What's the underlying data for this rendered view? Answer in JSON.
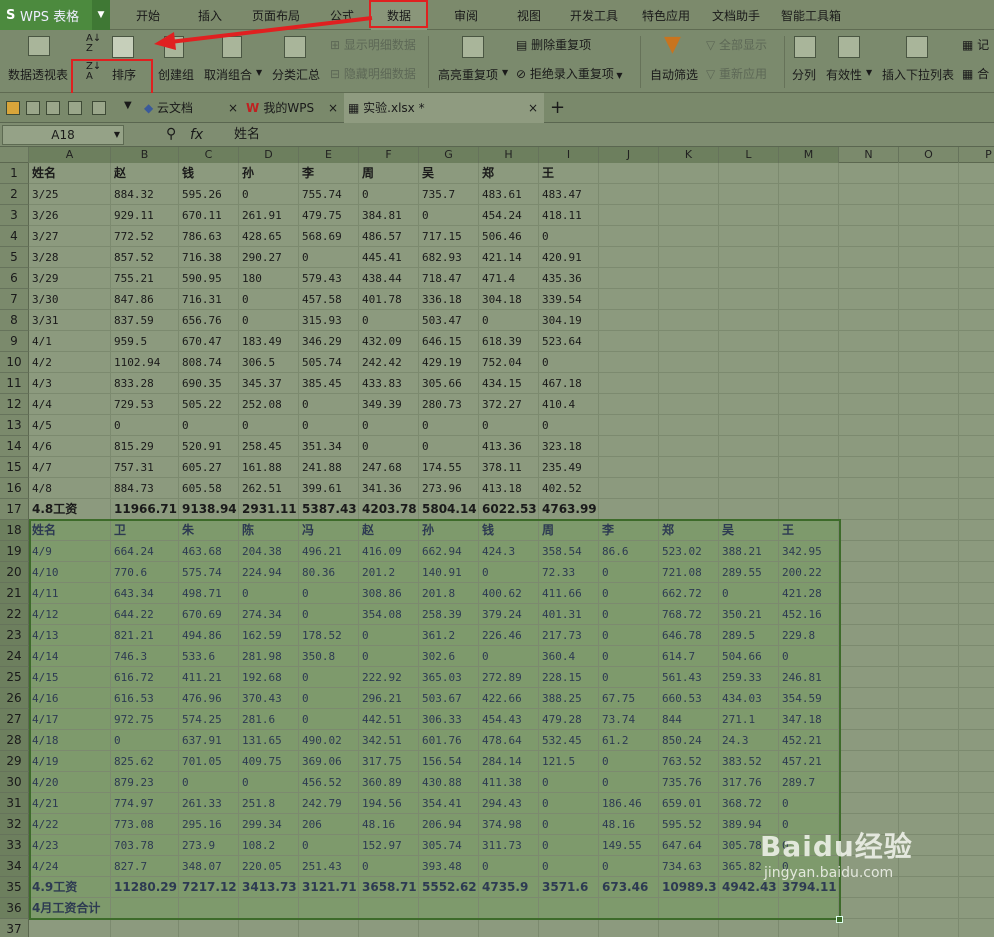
{
  "app": {
    "title": "WPS 表格"
  },
  "menu": {
    "tabs": [
      "开始",
      "插入",
      "页面布局",
      "公式",
      "数据",
      "审阅",
      "视图",
      "开发工具",
      "特色应用",
      "文档助手",
      "智能工具箱"
    ],
    "active": "数据"
  },
  "ribbon": {
    "pivot": "数据透视表",
    "sort": "排序",
    "create_group": "创建组",
    "ungroup": "取消组合",
    "subtotal": "分类汇总",
    "show_detail": "显示明细数据",
    "hide_detail": "隐藏明细数据",
    "highlight_dup": "高亮重复项",
    "remove_dup": "删除重复项",
    "reject_dup": "拒绝录入重复项",
    "autofilter": "自动筛选",
    "show_all": "全部显示",
    "reapply": "重新应用",
    "text_to_cols": "分列",
    "validity": "有效性",
    "dropdown_list": "插入下拉列表",
    "record": "记",
    "merge": "合"
  },
  "doc_tabs": [
    {
      "label": "云文档"
    },
    {
      "label": "我的WPS"
    },
    {
      "label": "实验.xlsx *"
    }
  ],
  "formula_bar": {
    "name_box": "A18",
    "fx": "fx",
    "value": "姓名"
  },
  "columns": [
    "A",
    "B",
    "C",
    "D",
    "E",
    "F",
    "G",
    "H",
    "I",
    "J",
    "K",
    "L",
    "M",
    "N",
    "O",
    "P"
  ],
  "rows": [
    [
      "姓名",
      "赵",
      "钱",
      "孙",
      "李",
      "周",
      "吴",
      "郑",
      "王"
    ],
    [
      "3/25",
      "884.32",
      "595.26",
      "0",
      "755.74",
      "0",
      "735.7",
      "483.61",
      "483.47"
    ],
    [
      "3/26",
      "929.11",
      "670.11",
      "261.91",
      "479.75",
      "384.81",
      "0",
      "454.24",
      "418.11"
    ],
    [
      "3/27",
      "772.52",
      "786.63",
      "428.65",
      "568.69",
      "486.57",
      "717.15",
      "506.46",
      "0"
    ],
    [
      "3/28",
      "857.52",
      "716.38",
      "290.27",
      "0",
      "445.41",
      "682.93",
      "421.14",
      "420.91"
    ],
    [
      "3/29",
      "755.21",
      "590.95",
      "180",
      "579.43",
      "438.44",
      "718.47",
      "471.4",
      "435.36"
    ],
    [
      "3/30",
      "847.86",
      "716.31",
      "0",
      "457.58",
      "401.78",
      "336.18",
      "304.18",
      "339.54"
    ],
    [
      "3/31",
      "837.59",
      "656.76",
      "0",
      "315.93",
      "0",
      "503.47",
      "0",
      "304.19"
    ],
    [
      "4/1",
      "959.5",
      "670.47",
      "183.49",
      "346.29",
      "432.09",
      "646.15",
      "618.39",
      "523.64"
    ],
    [
      "4/2",
      "1102.94",
      "808.74",
      "306.5",
      "505.74",
      "242.42",
      "429.19",
      "752.04",
      "0"
    ],
    [
      "4/3",
      "833.28",
      "690.35",
      "345.37",
      "385.45",
      "433.83",
      "305.66",
      "434.15",
      "467.18"
    ],
    [
      "4/4",
      "729.53",
      "505.22",
      "252.08",
      "0",
      "349.39",
      "280.73",
      "372.27",
      "410.4"
    ],
    [
      "4/5",
      "0",
      "0",
      "0",
      "0",
      "0",
      "0",
      "0",
      "0"
    ],
    [
      "4/6",
      "815.29",
      "520.91",
      "258.45",
      "351.34",
      "0",
      "0",
      "413.36",
      "323.18"
    ],
    [
      "4/7",
      "757.31",
      "605.27",
      "161.88",
      "241.88",
      "247.68",
      "174.55",
      "378.11",
      "235.49"
    ],
    [
      "4/8",
      "884.73",
      "605.58",
      "262.51",
      "399.61",
      "341.36",
      "273.96",
      "413.18",
      "402.52"
    ],
    [
      "4.8工资",
      "11966.71",
      "9138.94",
      "2931.11",
      "5387.43",
      "4203.78",
      "5804.14",
      "6022.53",
      "4763.99"
    ],
    [
      "姓名",
      "卫",
      "朱",
      "陈",
      "冯",
      "赵",
      "孙",
      "钱",
      "周",
      "李",
      "郑",
      "吴",
      "王"
    ],
    [
      "4/9",
      "664.24",
      "463.68",
      "204.38",
      "496.21",
      "416.09",
      "662.94",
      "424.3",
      "358.54",
      "86.6",
      "523.02",
      "388.21",
      "342.95"
    ],
    [
      "4/10",
      "770.6",
      "575.74",
      "224.94",
      "80.36",
      "201.2",
      "140.91",
      "0",
      "72.33",
      "0",
      "721.08",
      "289.55",
      "200.22"
    ],
    [
      "4/11",
      "643.34",
      "498.71",
      "0",
      "0",
      "308.86",
      "201.8",
      "400.62",
      "411.66",
      "0",
      "662.72",
      "0",
      "421.28"
    ],
    [
      "4/12",
      "644.22",
      "670.69",
      "274.34",
      "0",
      "354.08",
      "258.39",
      "379.24",
      "401.31",
      "0",
      "768.72",
      "350.21",
      "452.16"
    ],
    [
      "4/13",
      "821.21",
      "494.86",
      "162.59",
      "178.52",
      "0",
      "361.2",
      "226.46",
      "217.73",
      "0",
      "646.78",
      "289.5",
      "229.8"
    ],
    [
      "4/14",
      "746.3",
      "533.6",
      "281.98",
      "350.8",
      "0",
      "302.6",
      "0",
      "360.4",
      "0",
      "614.7",
      "504.66",
      "0"
    ],
    [
      "4/15",
      "616.72",
      "411.21",
      "192.68",
      "0",
      "222.92",
      "365.03",
      "272.89",
      "228.15",
      "0",
      "561.43",
      "259.33",
      "246.81"
    ],
    [
      "4/16",
      "616.53",
      "476.96",
      "370.43",
      "0",
      "296.21",
      "503.67",
      "422.66",
      "388.25",
      "67.75",
      "660.53",
      "434.03",
      "354.59"
    ],
    [
      "4/17",
      "972.75",
      "574.25",
      "281.6",
      "0",
      "442.51",
      "306.33",
      "454.43",
      "479.28",
      "73.74",
      "844",
      "271.1",
      "347.18"
    ],
    [
      "4/18",
      "0",
      "637.91",
      "131.65",
      "490.02",
      "342.51",
      "601.76",
      "478.64",
      "532.45",
      "61.2",
      "850.24",
      "24.3",
      "452.21"
    ],
    [
      "4/19",
      "825.62",
      "701.05",
      "409.75",
      "369.06",
      "317.75",
      "156.54",
      "284.14",
      "121.5",
      "0",
      "763.52",
      "383.52",
      "457.21"
    ],
    [
      "4/20",
      "879.23",
      "0",
      "0",
      "456.52",
      "360.89",
      "430.88",
      "411.38",
      "0",
      "0",
      "735.76",
      "317.76",
      "289.7"
    ],
    [
      "4/21",
      "774.97",
      "261.33",
      "251.8",
      "242.79",
      "194.56",
      "354.41",
      "294.43",
      "0",
      "186.46",
      "659.01",
      "368.72",
      "0"
    ],
    [
      "4/22",
      "773.08",
      "295.16",
      "299.34",
      "206",
      "48.16",
      "206.94",
      "374.98",
      "0",
      "48.16",
      "595.52",
      "389.94",
      "0"
    ],
    [
      "4/23",
      "703.78",
      "273.9",
      "108.2",
      "0",
      "152.97",
      "305.74",
      "311.73",
      "0",
      "149.55",
      "647.64",
      "305.78",
      "0"
    ],
    [
      "4/24",
      "827.7",
      "348.07",
      "220.05",
      "251.43",
      "0",
      "393.48",
      "0",
      "0",
      "0",
      "734.63",
      "365.82",
      "0"
    ],
    [
      "4.9工资",
      "11280.29",
      "7217.12",
      "3413.73",
      "3121.71",
      "3658.71",
      "5552.62",
      "4735.9",
      "3571.6",
      "673.46",
      "10989.3",
      "4942.43",
      "3794.11"
    ],
    [
      "4月工资合计"
    ],
    []
  ],
  "watermark": {
    "logo": "Baidu经验",
    "url": "jingyan.baidu.com"
  },
  "colors": {
    "accent": "#4c8a3e",
    "annotation": "#e02020",
    "selection": "#3d6b2a"
  }
}
